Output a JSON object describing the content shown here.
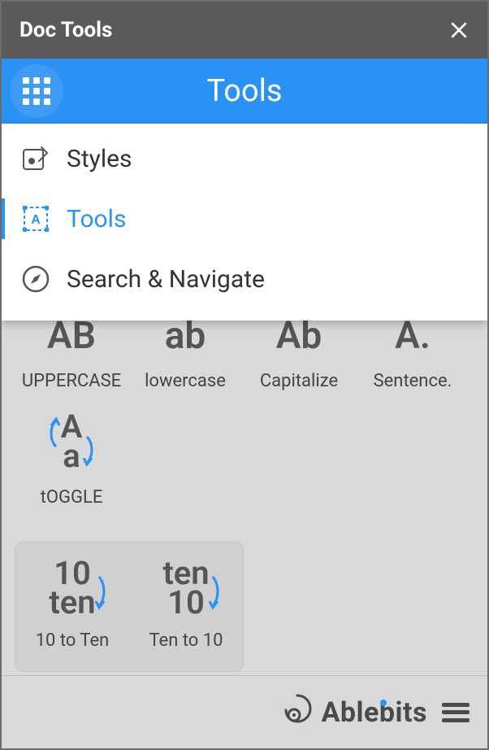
{
  "titlebar": {
    "title": "Doc Tools"
  },
  "header": {
    "title": "Tools"
  },
  "menu": [
    {
      "label": "Styles",
      "active": false
    },
    {
      "label": "Tools",
      "active": true
    },
    {
      "label": "Search & Navigate",
      "active": false
    }
  ],
  "case_row": [
    {
      "big": "AB",
      "label": "UPPERCASE"
    },
    {
      "big": "ab",
      "label": "lowercase"
    },
    {
      "big": "Ab",
      "label": "Capitalize"
    },
    {
      "big": "A.",
      "label": "Sentence."
    }
  ],
  "toggle_cell": {
    "top": "A",
    "bottom": "a",
    "label": "tOGGLE"
  },
  "num_row": [
    {
      "top": "10",
      "bottom": "ten",
      "label": "10 to Ten"
    },
    {
      "top": "ten",
      "bottom": "10",
      "label": "Ten to 10"
    }
  ],
  "footer": {
    "brand": "Ablebits"
  },
  "colors": {
    "accent": "#2a91f5"
  }
}
